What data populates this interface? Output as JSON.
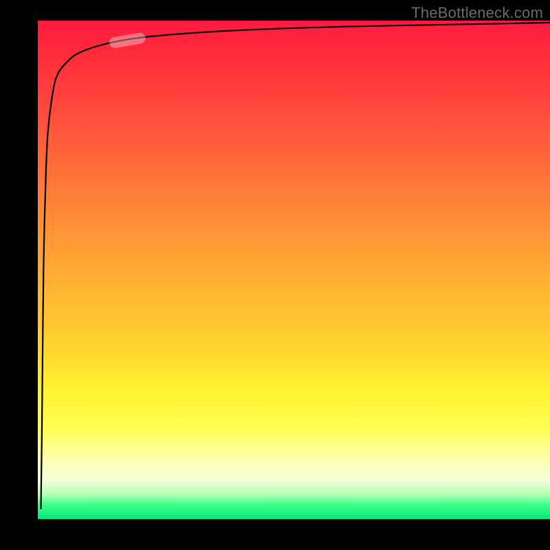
{
  "watermark": {
    "text": "TheBottleneck.com"
  },
  "colors": {
    "gradient_top": "#ff1a3f",
    "gradient_mid_upper": "#ff9336",
    "gradient_mid_lower": "#ffff55",
    "gradient_bottom": "#00e878",
    "curve": "#000000",
    "highlight": "rgba(255,255,255,0.35)",
    "background": "#000000"
  },
  "chart_data": {
    "type": "line",
    "title": "",
    "xlabel": "",
    "ylabel": "",
    "xlim": [
      0,
      100
    ],
    "ylim": [
      0,
      100
    ],
    "grid": false,
    "note": "Axes unlabeled in source image; values are inferred pixel-relative percentages. Curve rises sharply near x≈0 asymptote then flattens toward y≈100.",
    "series": [
      {
        "name": "curve",
        "x": [
          0.6,
          0.8,
          1.0,
          1.2,
          1.6,
          2.0,
          3.0,
          4.0,
          6.0,
          8.0,
          12.0,
          18.0,
          26.0,
          40.0,
          60.0,
          80.0,
          100.0
        ],
        "values": [
          2,
          18,
          40,
          55,
          70,
          78,
          86,
          89.5,
          92,
          93.5,
          95,
          96.3,
          97.2,
          98.1,
          98.8,
          99.2,
          99.6
        ]
      }
    ],
    "highlight_segment": {
      "x_start": 14,
      "x_end": 21,
      "note": "short pale capsule overlaid on curve"
    },
    "background_gradient": {
      "orientation": "vertical",
      "stops": [
        {
          "pos": 0.0,
          "color": "#ff1a3f"
        },
        {
          "pos": 0.3,
          "color": "#ff6f3a"
        },
        {
          "pos": 0.66,
          "color": "#ffd62f"
        },
        {
          "pos": 0.88,
          "color": "#ffffb0"
        },
        {
          "pos": 1.0,
          "color": "#00e878"
        }
      ]
    }
  }
}
